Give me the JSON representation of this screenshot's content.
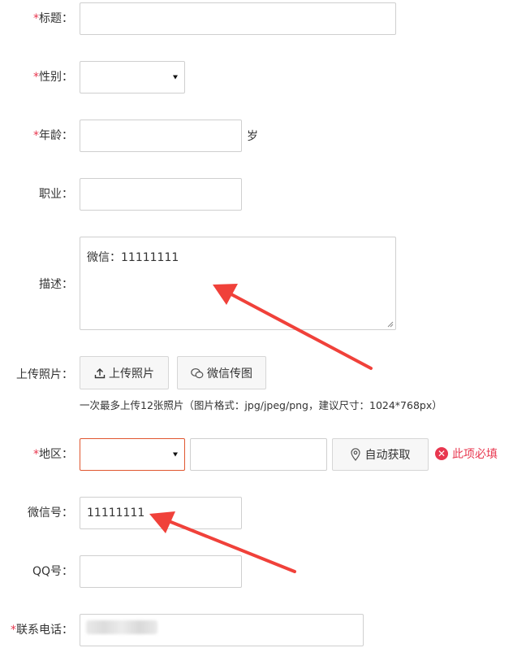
{
  "fields": {
    "title": {
      "required_mark": "*",
      "label": "标题："
    },
    "gender": {
      "required_mark": "*",
      "label": "性别："
    },
    "age": {
      "required_mark": "*",
      "label": "年龄：",
      "unit": "岁"
    },
    "job": {
      "label": "职业："
    },
    "desc": {
      "label": "描述：",
      "value": "微信：11111111"
    },
    "upload": {
      "label": "上传照片：",
      "upload_btn": "上传照片",
      "wechat_btn": "微信传图",
      "hint": "一次最多上传12张照片（图片格式：jpg/jpeg/png，建议尺寸：1024*768px）"
    },
    "region": {
      "required_mark": "*",
      "label": "地区：",
      "auto_btn": "自动获取",
      "error": "此项必填"
    },
    "wechat": {
      "label": "微信号：",
      "value": "11111111"
    },
    "qq": {
      "label": "QQ号："
    },
    "phone": {
      "required_mark": "*",
      "label": "联系电话："
    }
  },
  "colors": {
    "required": "#e8374f",
    "error_border": "#e0562f",
    "arrow": "#f0413a"
  }
}
